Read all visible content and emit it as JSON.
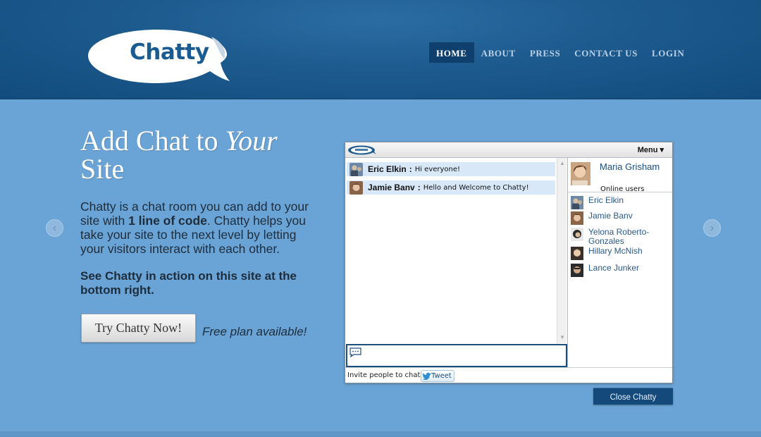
{
  "brand": {
    "logo_text": "Chatty"
  },
  "nav": [
    {
      "label": "HOME",
      "active": true
    },
    {
      "label": "ABOUT",
      "active": false
    },
    {
      "label": "PRESS",
      "active": false
    },
    {
      "label": "CONTACT US",
      "active": false
    },
    {
      "label": "LOGIN",
      "active": false
    }
  ],
  "hero": {
    "title_part1": "Add Chat to ",
    "title_italic": "Your",
    "title_part2": "Site",
    "desc_part1": "Chatty is a chat room you can add to your site with ",
    "desc_bold": "1 line of code",
    "desc_part2": ". Chatty helps you take your site to the next level by letting your visitors interact with each other.",
    "cta_text": "See Chatty in action on this site at the bottom right.",
    "try_button": "Try Chatty Now!",
    "free_plan": "Free plan available!"
  },
  "chat": {
    "menu_label": "Menu ▾",
    "messages": [
      {
        "name": "Eric Elkin",
        "separator": " :",
        "text": "Hi everyone!"
      },
      {
        "name": "Jamie Banv",
        "separator": " :",
        "text": "Hello and Welcome to Chatty!"
      }
    ],
    "current_user": "Maria Grisham",
    "online_label": "Online users",
    "users": [
      {
        "name": "Eric Elkin"
      },
      {
        "name": "Jamie Banv"
      },
      {
        "name": "Yelona Roberto-Gonzales"
      },
      {
        "name": "Hillary McNish"
      },
      {
        "name": "Lance Junker"
      }
    ],
    "invite_label": "Invite people to chat:",
    "tweet_label": "Tweet",
    "close_button": "Close Chatty"
  },
  "arrows": {
    "left": "‹",
    "right": "›"
  },
  "colors": {
    "header": "#1d5a8e",
    "page": "#6aa3d5",
    "accent": "#14497c",
    "message_bg": "#d8e8f8"
  }
}
